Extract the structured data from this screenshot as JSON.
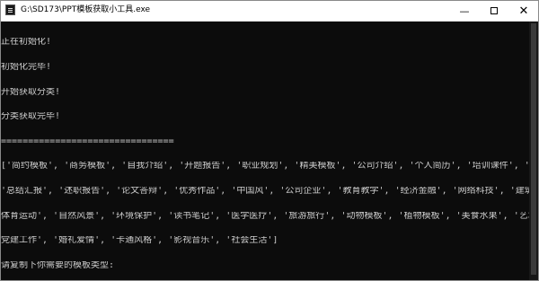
{
  "window": {
    "title": "G:\\SD173\\PPT模板获取小工具.exe",
    "controls": {
      "minimize": "—",
      "close": "✕"
    }
  },
  "console": {
    "lines": [
      "正在初始化!",
      "初始化完毕!",
      "开始获取分类!",
      "分类获取完毕!",
      "================================",
      "['简约模板', '商务模板', '自我介绍', '开题报告', '职业规划', '精美模板', '公司介绍', '个人简历', '培训课件', '动态模板',",
      "'总结汇报', '述职报告', '论文答辩', '优秀作品', '中国风', '公司企业', '教育教学', '经济金融', '网络科技', '建筑地产',",
      "体育运动', '自然风景', '环境保护', '读书笔记', '医学医疗', '旅游旅行', '动物模板', '植物模板', '美食水果', '艺术抽象',",
      "党建工作', '婚礼爱情', '卡通风格', '影视音乐', '社会生活']",
      "请复制下你需要的模板类型:"
    ]
  }
}
